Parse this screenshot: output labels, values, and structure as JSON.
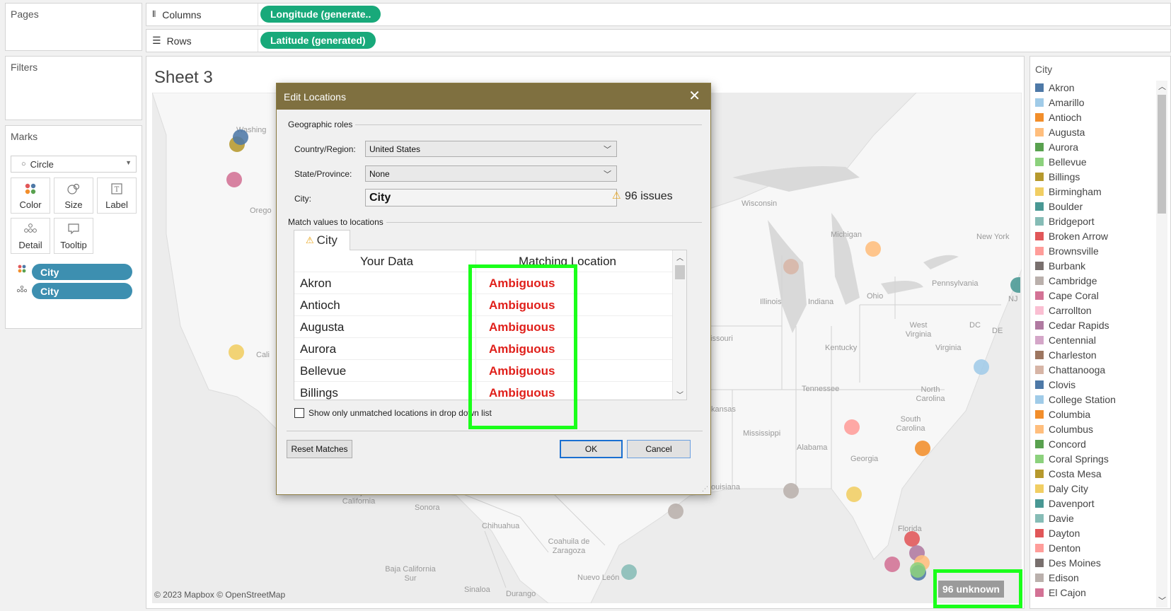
{
  "pages_panel": {
    "title": "Pages"
  },
  "filters_panel": {
    "title": "Filters"
  },
  "columns_shelf": {
    "label": "Columns",
    "pill": "Longitude (generate.."
  },
  "rows_shelf": {
    "label": "Rows",
    "pill": "Latitude (generated)"
  },
  "marks_panel": {
    "title": "Marks",
    "mark_type": "Circle",
    "buttons": [
      {
        "label": "Color",
        "icon": "color-icon"
      },
      {
        "label": "Size",
        "icon": "size-icon"
      },
      {
        "label": "Label",
        "icon": "label-icon"
      },
      {
        "label": "Detail",
        "icon": "detail-icon"
      },
      {
        "label": "Tooltip",
        "icon": "tooltip-icon"
      }
    ],
    "pills": [
      {
        "label": "City",
        "icon": "color-icon"
      },
      {
        "label": "City",
        "icon": "detail-icon"
      }
    ]
  },
  "sheet": {
    "title": "Sheet 3",
    "attribution": "© 2023 Mapbox © OpenStreetMap",
    "unknown_badge": "96 unknown",
    "map_labels": [
      "Washing",
      "Orego",
      "Cali",
      "Baja California",
      "Sonora",
      "Chihuahua",
      "Coahuila de Zaragoza",
      "Baja California Sur",
      "Sinaloa",
      "Durango",
      "Nuevo León",
      "Wisconsin",
      "Michigan",
      "New York",
      "Pennsylvania",
      "Illinois",
      "Indiana",
      "Ohio",
      "West Virginia",
      "Virginia",
      "Kentucky",
      "Tennessee",
      "North Carolina",
      "South Carolina",
      "Georgia",
      "Alabama",
      "Mississippi",
      "Florida",
      "issouri",
      "kansas",
      "ouisiana",
      "DC",
      "DE",
      "NJ"
    ]
  },
  "legend": {
    "title": "City",
    "items": [
      {
        "name": "Akron",
        "color": "#4e79a7"
      },
      {
        "name": "Amarillo",
        "color": "#a0cbe8"
      },
      {
        "name": "Antioch",
        "color": "#f28e2b"
      },
      {
        "name": "Augusta",
        "color": "#ffbe7d"
      },
      {
        "name": "Aurora",
        "color": "#59a14f"
      },
      {
        "name": "Bellevue",
        "color": "#8cd17d"
      },
      {
        "name": "Billings",
        "color": "#b6992d"
      },
      {
        "name": "Birmingham",
        "color": "#f1ce63"
      },
      {
        "name": "Boulder",
        "color": "#499894"
      },
      {
        "name": "Bridgeport",
        "color": "#86bcb6"
      },
      {
        "name": "Broken Arrow",
        "color": "#e15759"
      },
      {
        "name": "Brownsville",
        "color": "#ff9d9a"
      },
      {
        "name": "Burbank",
        "color": "#79706e"
      },
      {
        "name": "Cambridge",
        "color": "#bab0ac"
      },
      {
        "name": "Cape Coral",
        "color": "#d37295"
      },
      {
        "name": "Carrollton",
        "color": "#fabfd2"
      },
      {
        "name": "Cedar Rapids",
        "color": "#b07aa1"
      },
      {
        "name": "Centennial",
        "color": "#d4a6c8"
      },
      {
        "name": "Charleston",
        "color": "#9d7660"
      },
      {
        "name": "Chattanooga",
        "color": "#d7b5a6"
      },
      {
        "name": "Clovis",
        "color": "#4e79a7"
      },
      {
        "name": "College Station",
        "color": "#a0cbe8"
      },
      {
        "name": "Columbia",
        "color": "#f28e2b"
      },
      {
        "name": "Columbus",
        "color": "#ffbe7d"
      },
      {
        "name": "Concord",
        "color": "#59a14f"
      },
      {
        "name": "Coral Springs",
        "color": "#8cd17d"
      },
      {
        "name": "Costa Mesa",
        "color": "#b6992d"
      },
      {
        "name": "Daly City",
        "color": "#f1ce63"
      },
      {
        "name": "Davenport",
        "color": "#499894"
      },
      {
        "name": "Davie",
        "color": "#86bcb6"
      },
      {
        "name": "Dayton",
        "color": "#e15759"
      },
      {
        "name": "Denton",
        "color": "#ff9d9a"
      },
      {
        "name": "Des Moines",
        "color": "#79706e"
      },
      {
        "name": "Edison",
        "color": "#bab0ac"
      },
      {
        "name": "El Cajon",
        "color": "#d37295"
      }
    ]
  },
  "dialog": {
    "title": "Edit Locations",
    "section_roles": "Geographic roles",
    "country_label": "Country/Region:",
    "country_value": "United States",
    "state_label": "State/Province:",
    "state_value": "None",
    "city_label": "City:",
    "city_value": "City",
    "issues": "96 issues",
    "section_match": "Match values to locations",
    "tab_label": "City",
    "col_your_data": "Your Data",
    "col_matching": "Matching Location",
    "rows": [
      {
        "data": "Akron",
        "match": "Ambiguous"
      },
      {
        "data": "Antioch",
        "match": "Ambiguous"
      },
      {
        "data": "Augusta",
        "match": "Ambiguous"
      },
      {
        "data": "Aurora",
        "match": "Ambiguous"
      },
      {
        "data": "Bellevue",
        "match": "Ambiguous"
      },
      {
        "data": "Billings",
        "match": "Ambiguous"
      }
    ],
    "checkbox_label": "Show only unmatched locations in drop down list",
    "reset_label": "Reset Matches",
    "ok_label": "OK",
    "cancel_label": "Cancel"
  }
}
